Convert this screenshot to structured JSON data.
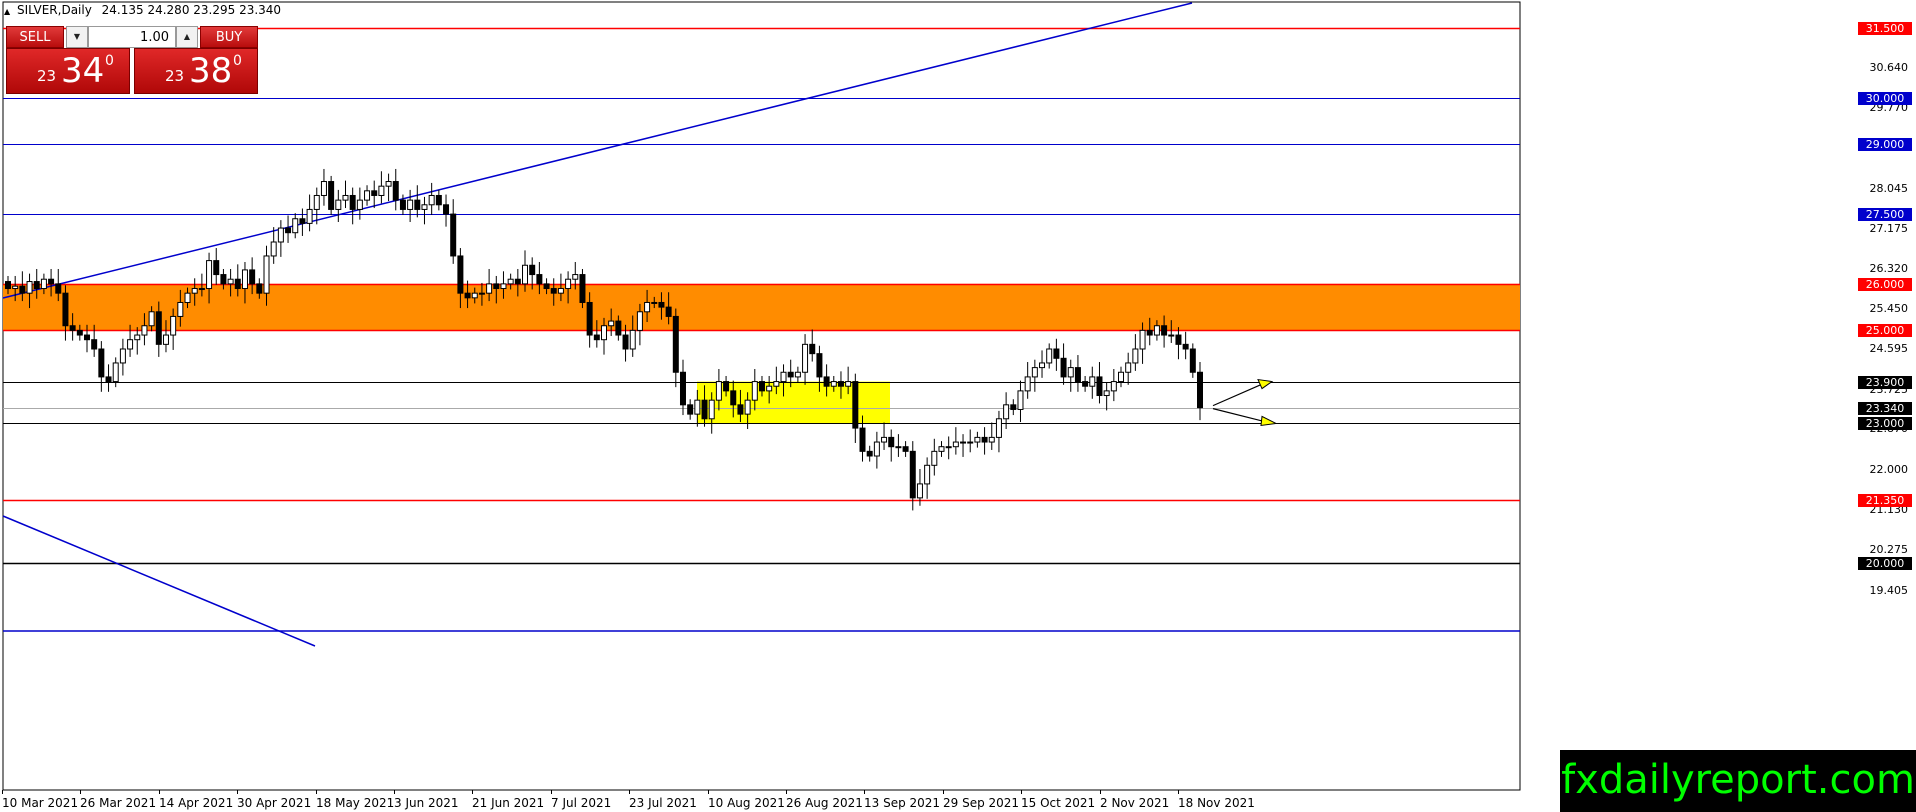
{
  "symbol": {
    "name": "SILVER,Daily",
    "ohlc": "24.135 24.280 23.295 23.340"
  },
  "trade_panel": {
    "sell_label": "SELL",
    "buy_label": "BUY",
    "lot": "1.00",
    "sell_price": {
      "prefix": "23",
      "big": "34",
      "sup": "0"
    },
    "buy_price": {
      "prefix": "23",
      "big": "38",
      "sup": "0"
    }
  },
  "colors": {
    "red_level": "#ff0000",
    "blue_level": "#0000cc",
    "black_level": "#000000",
    "resistance_zone": "#ff8c00",
    "consolidation_zone": "#ffff00",
    "watermark_text": "#00ff00"
  },
  "chart_data": {
    "type": "candlestick",
    "symbol": "SILVER",
    "timeframe": "Daily",
    "y_range": [
      18.9,
      32.0
    ],
    "price_ticks": [
      "30.640",
      "29.770",
      "28.045",
      "27.175",
      "26.320",
      "25.450",
      "24.595",
      "23.725",
      "22.870",
      "22.000",
      "21.130",
      "20.275",
      "19.405"
    ],
    "price_tick_values": [
      30.64,
      29.77,
      28.045,
      27.175,
      26.32,
      25.45,
      24.595,
      23.725,
      22.87,
      22.0,
      21.13,
      20.275,
      19.405
    ],
    "date_labels": [
      "10 Mar 2021",
      "26 Mar 2021",
      "14 Apr 2021",
      "30 Apr 2021",
      "18 May 2021",
      "3 Jun 2021",
      "21 Jun 2021",
      "7 Jul 2021",
      "23 Jul 2021",
      "10 Aug 2021",
      "26 Aug 2021",
      "13 Sep 2021",
      "29 Sep 2021",
      "15 Oct 2021",
      "2 Nov 2021",
      "18 Nov 2021"
    ],
    "levels": [
      {
        "label": "31.500",
        "value": 31.5,
        "color": "red"
      },
      {
        "label": "30.000",
        "value": 30.0,
        "color": "blue"
      },
      {
        "label": "29.000",
        "value": 29.0,
        "color": "blue"
      },
      {
        "label": "27.500",
        "value": 27.5,
        "color": "blue"
      },
      {
        "label": "26.000",
        "value": 26.0,
        "color": "red"
      },
      {
        "label": "25.000",
        "value": 25.0,
        "color": "red"
      },
      {
        "label": "23.900",
        "value": 23.9,
        "color": "black"
      },
      {
        "label": "23.340",
        "value": 23.34,
        "color": "black"
      },
      {
        "label": "23.000",
        "value": 23.0,
        "color": "black"
      },
      {
        "label": "21.350",
        "value": 21.35,
        "color": "red"
      },
      {
        "label": "20.000",
        "value": 20.0,
        "color": "black"
      }
    ],
    "zones": [
      {
        "name": "resistance",
        "low": 25.0,
        "high": 26.0,
        "color": "orange"
      },
      {
        "name": "consolidation",
        "low": 23.0,
        "high": 23.9,
        "color": "yellow"
      }
    ],
    "closes": [
      25.9,
      25.95,
      25.8,
      26.05,
      25.9,
      26.1,
      26.0,
      25.8,
      25.1,
      25.0,
      24.9,
      24.8,
      24.6,
      24.0,
      23.9,
      24.3,
      24.6,
      24.8,
      24.9,
      25.1,
      25.4,
      24.7,
      24.9,
      25.3,
      25.6,
      25.8,
      25.9,
      25.9,
      26.5,
      26.2,
      26.0,
      26.1,
      25.9,
      26.3,
      26.0,
      25.8,
      26.6,
      26.9,
      27.2,
      27.1,
      27.4,
      27.3,
      27.6,
      27.9,
      28.2,
      27.6,
      27.8,
      27.9,
      27.6,
      27.8,
      28.0,
      27.9,
      28.1,
      28.2,
      27.8,
      27.6,
      27.8,
      27.6,
      27.7,
      27.9,
      27.7,
      27.5,
      26.6,
      25.8,
      25.7,
      25.8,
      25.8,
      26.0,
      25.9,
      26.0,
      26.1,
      26.0,
      26.4,
      26.2,
      26.0,
      25.9,
      25.8,
      25.9,
      26.1,
      26.2,
      25.6,
      24.9,
      24.8,
      25.1,
      25.2,
      24.9,
      24.6,
      25.0,
      25.4,
      25.6,
      25.6,
      25.5,
      25.3,
      24.1,
      23.4,
      23.2,
      23.5,
      23.1,
      23.5,
      23.9,
      23.7,
      23.4,
      23.2,
      23.5,
      23.9,
      23.7,
      23.8,
      23.9,
      24.1,
      24.0,
      24.1,
      24.7,
      24.5,
      24.0,
      23.8,
      23.9,
      23.8,
      23.9,
      22.9,
      22.4,
      22.3,
      22.6,
      22.7,
      22.5,
      22.5,
      22.4,
      21.4,
      21.7,
      22.1,
      22.4,
      22.5,
      22.5,
      22.6,
      22.6,
      22.6,
      22.7,
      22.6,
      22.7,
      23.1,
      23.4,
      23.3,
      23.7,
      24.0,
      24.2,
      24.3,
      24.6,
      24.4,
      24.0,
      24.2,
      23.9,
      23.8,
      24.0,
      23.6,
      23.7,
      23.9,
      24.1,
      24.3,
      24.6,
      25.0,
      24.9,
      25.1,
      24.9,
      24.9,
      24.7,
      24.6,
      24.1,
      23.34
    ]
  },
  "watermark": "fxdailyreport.com"
}
